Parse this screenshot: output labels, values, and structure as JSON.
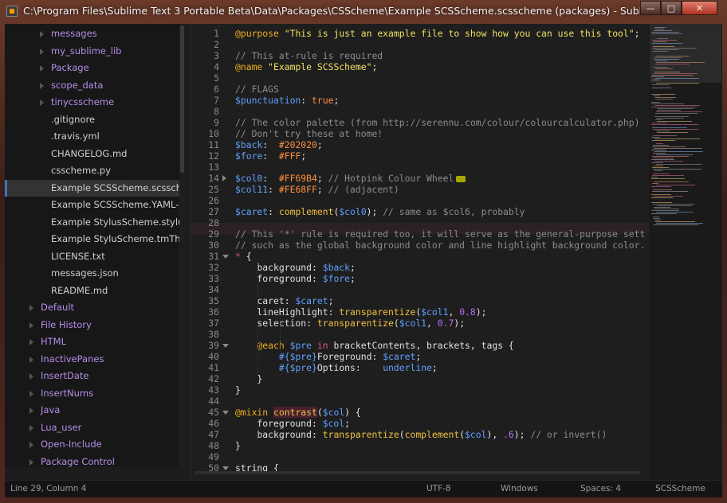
{
  "window": {
    "title": "C:\\Program Files\\Sublime Text 3 Portable Beta\\Data\\Packages\\CSScheme\\Example SCSScheme.scsscheme (packages) - Sublime Text",
    "controls": {
      "minimize": "—",
      "maximize": "□",
      "close": "✕"
    }
  },
  "sidebar": {
    "items": [
      {
        "label": "messages",
        "type": "folder",
        "level": 2
      },
      {
        "label": "my_sublime_lib",
        "type": "folder",
        "level": 2
      },
      {
        "label": "Package",
        "type": "folder",
        "level": 2
      },
      {
        "label": "scope_data",
        "type": "folder",
        "level": 2
      },
      {
        "label": "tinycsscheme",
        "type": "folder",
        "level": 2
      },
      {
        "label": ".gitignore",
        "type": "file",
        "level": 2
      },
      {
        "label": ".travis.yml",
        "type": "file",
        "level": 2
      },
      {
        "label": "CHANGELOG.md",
        "type": "file",
        "level": 2
      },
      {
        "label": "csscheme.py",
        "type": "file",
        "level": 2
      },
      {
        "label": "Example SCSScheme.scsscheme",
        "type": "file",
        "level": 2,
        "selected": true
      },
      {
        "label": "Example SCSScheme.YAML-tmTheme",
        "type": "file",
        "level": 2
      },
      {
        "label": "Example StylusScheme.styluscheme",
        "type": "file",
        "level": 2
      },
      {
        "label": "Example StyluScheme.tmTheme",
        "type": "file",
        "level": 2
      },
      {
        "label": "LICENSE.txt",
        "type": "file",
        "level": 2
      },
      {
        "label": "messages.json",
        "type": "file",
        "level": 2
      },
      {
        "label": "README.md",
        "type": "file",
        "level": 2
      },
      {
        "label": "Default",
        "type": "folder",
        "level": 1
      },
      {
        "label": "File History",
        "type": "folder",
        "level": 1
      },
      {
        "label": "HTML",
        "type": "folder",
        "level": 1
      },
      {
        "label": "InactivePanes",
        "type": "folder",
        "level": 1
      },
      {
        "label": "InsertDate",
        "type": "folder",
        "level": 1
      },
      {
        "label": "InsertNums",
        "type": "folder",
        "level": 1
      },
      {
        "label": "Java",
        "type": "folder",
        "level": 1
      },
      {
        "label": "Lua_user",
        "type": "folder",
        "level": 1
      },
      {
        "label": "Open-Include",
        "type": "folder",
        "level": 1
      },
      {
        "label": "Package Control",
        "type": "folder",
        "level": 1
      }
    ]
  },
  "editor": {
    "lines": [
      {
        "n": "1",
        "fold": "",
        "tokens": [
          [
            "key",
            "@purpose"
          ],
          [
            "txt",
            " "
          ],
          [
            "str",
            "\"This is just an example file to show how you can use this tool\""
          ],
          [
            "txt",
            ";"
          ]
        ]
      },
      {
        "n": "2",
        "fold": "",
        "tokens": []
      },
      {
        "n": "3",
        "fold": "",
        "tokens": [
          [
            "cmt",
            "// This at-rule is required"
          ]
        ]
      },
      {
        "n": "4",
        "fold": "",
        "tokens": [
          [
            "key",
            "@name"
          ],
          [
            "txt",
            " "
          ],
          [
            "str",
            "\"Example SCSScheme\""
          ],
          [
            "txt",
            ";"
          ]
        ]
      },
      {
        "n": "5",
        "fold": "",
        "tokens": []
      },
      {
        "n": "6",
        "fold": "",
        "tokens": [
          [
            "cmt",
            "// FLAGS"
          ]
        ]
      },
      {
        "n": "7",
        "fold": "",
        "tokens": [
          [
            "var",
            "$punctuation"
          ],
          [
            "txt",
            ": "
          ],
          [
            "val",
            "true"
          ],
          [
            "txt",
            ";"
          ]
        ]
      },
      {
        "n": "8",
        "fold": "",
        "tokens": []
      },
      {
        "n": "9",
        "fold": "",
        "tokens": [
          [
            "cmt",
            "// The color palette (from http://serennu.com/colour/colourcalculator.php)"
          ]
        ]
      },
      {
        "n": "10",
        "fold": "",
        "tokens": [
          [
            "cmt",
            "// Don't try these at home!"
          ]
        ]
      },
      {
        "n": "11",
        "fold": "",
        "tokens": [
          [
            "var",
            "$back"
          ],
          [
            "txt",
            ":  "
          ],
          [
            "val",
            "#202020"
          ],
          [
            "txt",
            ";"
          ]
        ]
      },
      {
        "n": "12",
        "fold": "",
        "tokens": [
          [
            "var",
            "$fore"
          ],
          [
            "txt",
            ":  "
          ],
          [
            "val",
            "#FFF"
          ],
          [
            "txt",
            ";"
          ]
        ]
      },
      {
        "n": "13",
        "fold": "",
        "tokens": []
      },
      {
        "n": "14",
        "fold": "right",
        "tokens": [
          [
            "var",
            "$col0"
          ],
          [
            "txt",
            ":  "
          ],
          [
            "val",
            "#FF69B4"
          ],
          [
            "txt",
            "; "
          ],
          [
            "cmt",
            "// Hotpink Colour Wheel"
          ],
          [
            "ell",
            ""
          ]
        ]
      },
      {
        "n": "25",
        "fold": "",
        "tokens": [
          [
            "var",
            "$col11"
          ],
          [
            "txt",
            ": "
          ],
          [
            "val",
            "#FE68FF"
          ],
          [
            "txt",
            "; "
          ],
          [
            "cmt",
            "// (adjacent)"
          ]
        ]
      },
      {
        "n": "26",
        "fold": "",
        "tokens": []
      },
      {
        "n": "27",
        "fold": "",
        "tokens": [
          [
            "var",
            "$caret"
          ],
          [
            "txt",
            ": "
          ],
          [
            "fn",
            "complement"
          ],
          [
            "txt",
            "("
          ],
          [
            "var",
            "$col0"
          ],
          [
            "txt",
            "); "
          ],
          [
            "cmt",
            "// same as $col6, probably"
          ]
        ]
      },
      {
        "n": "28",
        "fold": "",
        "tokens": []
      },
      {
        "n": "29",
        "fold": "",
        "tokens": [
          [
            "cmt",
            "// This '*' rule is required too, it will serve as the general-purpose sett"
          ]
        ]
      },
      {
        "n": "30",
        "fold": "",
        "tokens": [
          [
            "cmt",
            "// such as the global background color and line highlight background color."
          ]
        ]
      },
      {
        "n": "31",
        "fold": "down",
        "tokens": [
          [
            "kw",
            "*"
          ],
          [
            "txt",
            " {"
          ]
        ]
      },
      {
        "n": "32",
        "fold": "",
        "tokens": [
          [
            "txt",
            "    background: "
          ],
          [
            "var",
            "$back"
          ],
          [
            "txt",
            ";"
          ]
        ]
      },
      {
        "n": "33",
        "fold": "",
        "tokens": [
          [
            "txt",
            "    foreground: "
          ],
          [
            "var",
            "$fore"
          ],
          [
            "txt",
            ";"
          ]
        ]
      },
      {
        "n": "34",
        "fold": "",
        "tokens": []
      },
      {
        "n": "35",
        "fold": "",
        "tokens": [
          [
            "txt",
            "    caret: "
          ],
          [
            "var",
            "$caret"
          ],
          [
            "txt",
            ";"
          ]
        ]
      },
      {
        "n": "36",
        "fold": "",
        "tokens": [
          [
            "txt",
            "    lineHighlight: "
          ],
          [
            "fn",
            "transparentize"
          ],
          [
            "txt",
            "("
          ],
          [
            "var",
            "$col1"
          ],
          [
            "txt",
            ", "
          ],
          [
            "num",
            "0.8"
          ],
          [
            "txt",
            ");"
          ]
        ]
      },
      {
        "n": "37",
        "fold": "",
        "tokens": [
          [
            "txt",
            "    selection: "
          ],
          [
            "fn",
            "transparentize"
          ],
          [
            "txt",
            "("
          ],
          [
            "var",
            "$col1"
          ],
          [
            "txt",
            ", "
          ],
          [
            "num",
            "0.7"
          ],
          [
            "txt",
            ");"
          ]
        ]
      },
      {
        "n": "38",
        "fold": "",
        "tokens": []
      },
      {
        "n": "39",
        "fold": "down",
        "tokens": [
          [
            "txt",
            "    "
          ],
          [
            "key",
            "@each"
          ],
          [
            "txt",
            " "
          ],
          [
            "var",
            "$pre"
          ],
          [
            "txt",
            " "
          ],
          [
            "kw",
            "in"
          ],
          [
            "txt",
            " bracketContents, brackets, tags {"
          ]
        ]
      },
      {
        "n": "40",
        "fold": "",
        "tokens": [
          [
            "txt",
            "        "
          ],
          [
            "var",
            "#{$pre}"
          ],
          [
            "txt",
            "Foreground: "
          ],
          [
            "var",
            "$caret"
          ],
          [
            "txt",
            ";"
          ]
        ]
      },
      {
        "n": "41",
        "fold": "",
        "tokens": [
          [
            "txt",
            "        "
          ],
          [
            "var",
            "#{$pre}"
          ],
          [
            "txt",
            "Options:    "
          ],
          [
            "var",
            "underline"
          ],
          [
            "txt",
            ";"
          ]
        ]
      },
      {
        "n": "42",
        "fold": "",
        "tokens": [
          [
            "txt",
            "    }"
          ]
        ]
      },
      {
        "n": "43",
        "fold": "",
        "tokens": [
          [
            "txt",
            "}"
          ]
        ]
      },
      {
        "n": "44",
        "fold": "",
        "tokens": []
      },
      {
        "n": "45",
        "fold": "down",
        "tokens": [
          [
            "key",
            "@mixin"
          ],
          [
            "txt",
            " "
          ],
          [
            "hlfn",
            "contrast"
          ],
          [
            "txt",
            "("
          ],
          [
            "var",
            "$col"
          ],
          [
            "txt",
            ") {"
          ]
        ]
      },
      {
        "n": "46",
        "fold": "",
        "tokens": [
          [
            "txt",
            "    foreground: "
          ],
          [
            "var",
            "$col"
          ],
          [
            "txt",
            ";"
          ]
        ]
      },
      {
        "n": "47",
        "fold": "",
        "tokens": [
          [
            "txt",
            "    background: "
          ],
          [
            "fn",
            "transparentize"
          ],
          [
            "txt",
            "("
          ],
          [
            "fn",
            "complement"
          ],
          [
            "txt",
            "("
          ],
          [
            "var",
            "$col"
          ],
          [
            "txt",
            "), "
          ],
          [
            "num",
            ".6"
          ],
          [
            "txt",
            "); "
          ],
          [
            "cmt",
            "// or invert()"
          ]
        ]
      },
      {
        "n": "48",
        "fold": "",
        "tokens": [
          [
            "txt",
            "}"
          ]
        ]
      },
      {
        "n": "49",
        "fold": "",
        "tokens": []
      },
      {
        "n": "50",
        "fold": "down",
        "tokens": [
          [
            "txt",
            "string {"
          ]
        ]
      }
    ]
  },
  "statusbar": {
    "position": "Line 29, Column 4",
    "encoding": "UTF-8",
    "line_endings": "Windows",
    "indentation": "Spaces: 4",
    "syntax": "SCSScheme"
  },
  "colors": {
    "sidebar_folder": "#b58ee8",
    "sidebar_file": "#cfcfcf",
    "selection_marker": "#3a78b8",
    "editor_bg": "#1e1e1e",
    "at_rule": "#f0b020",
    "string": "#f0e060",
    "comment": "#8c8c8c",
    "variable": "#60a0ff",
    "value": "#ff9040",
    "keyword": "#e05090"
  }
}
